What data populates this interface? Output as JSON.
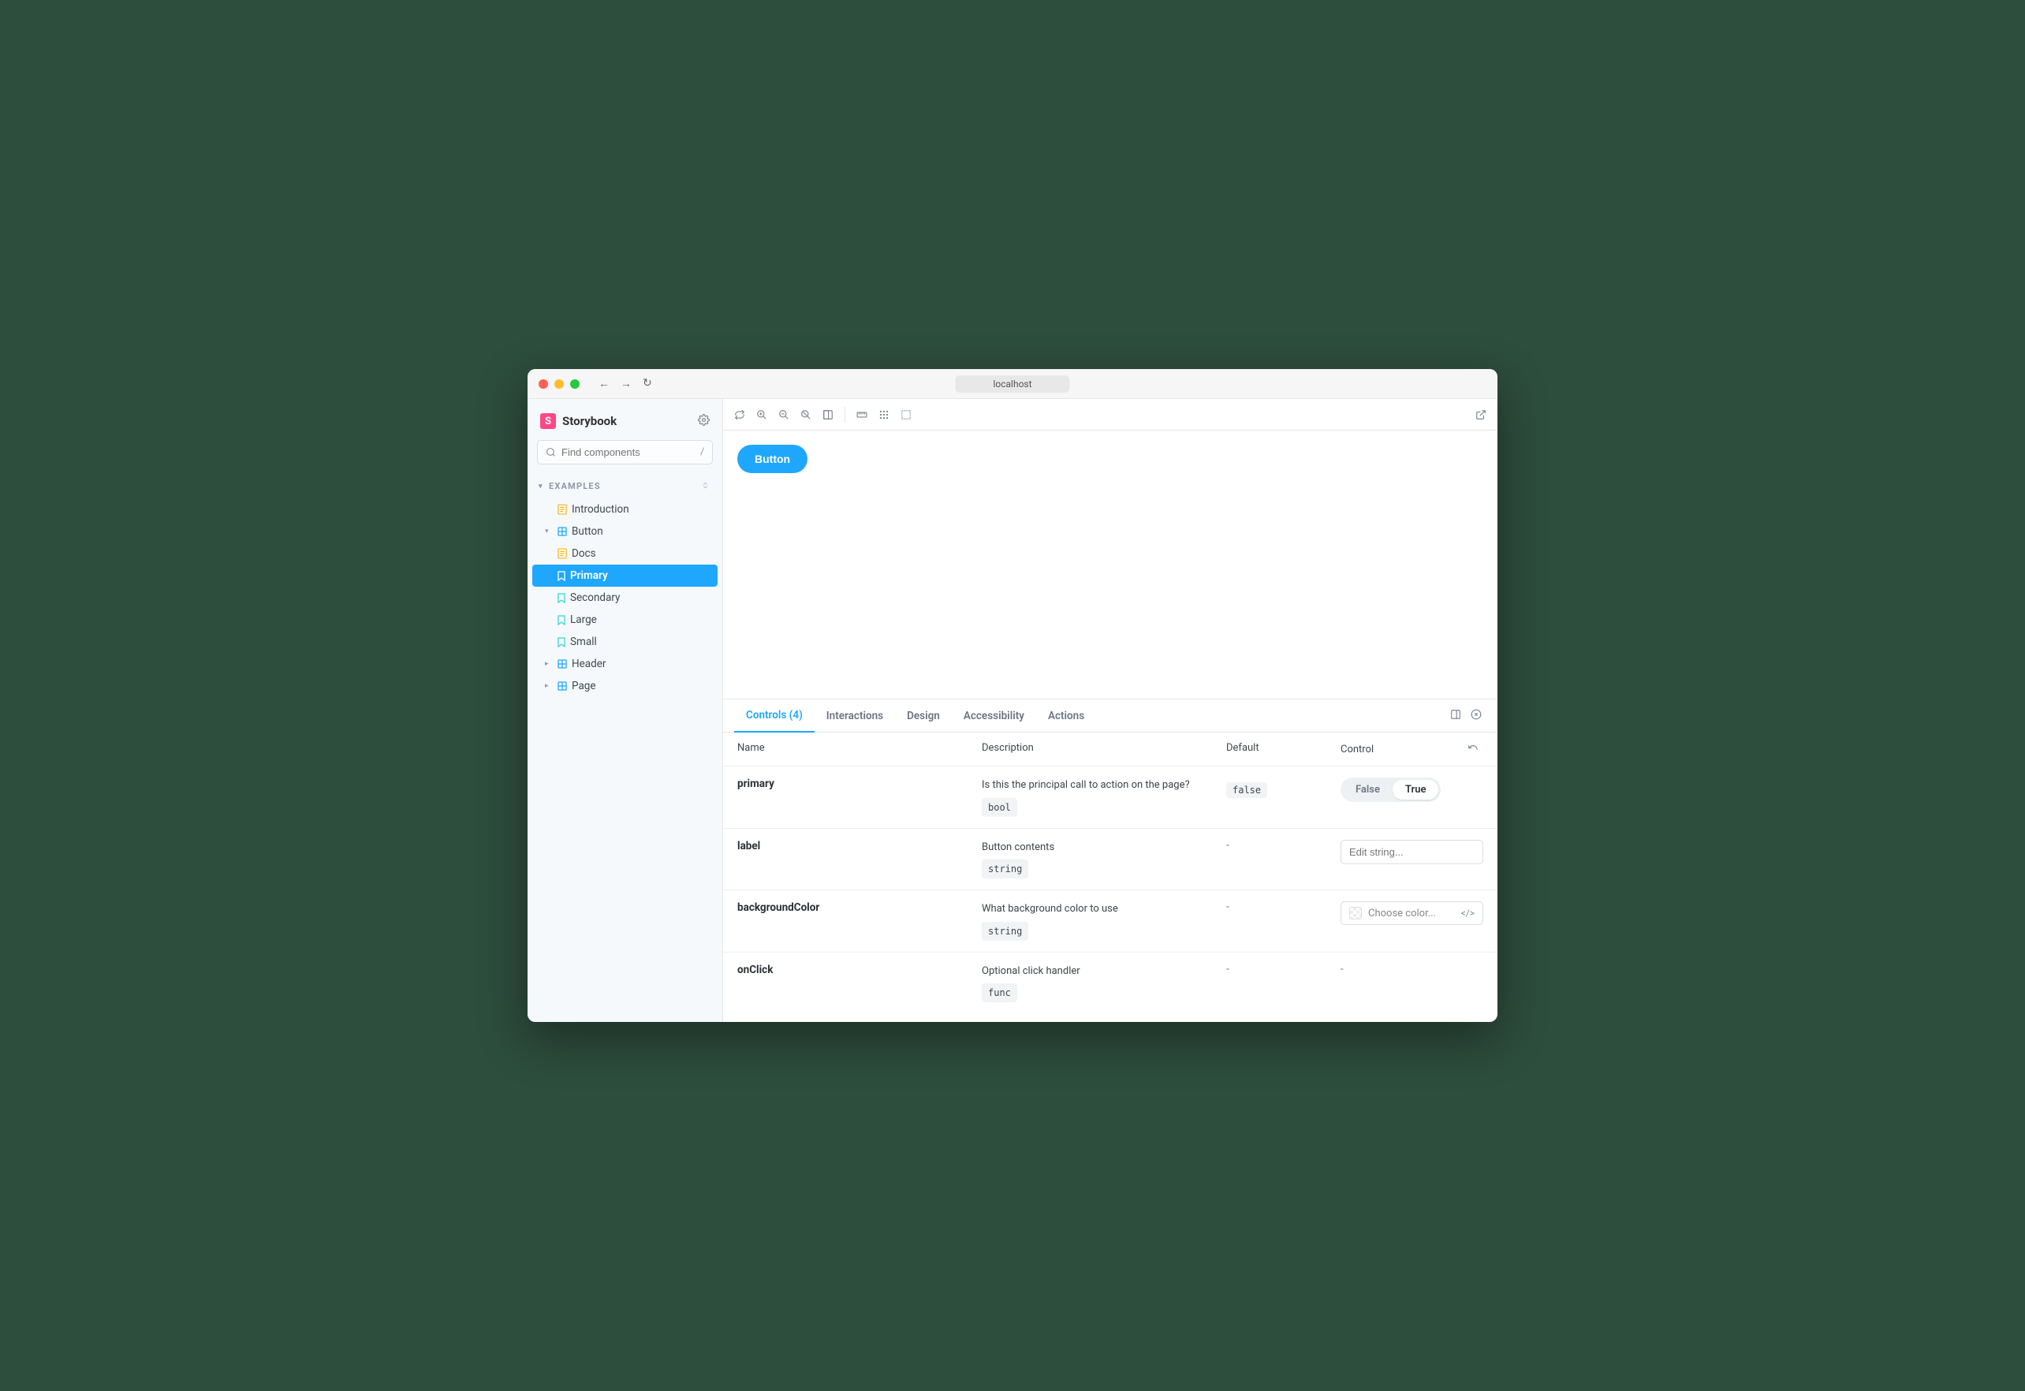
{
  "browser": {
    "url_label": "localhost"
  },
  "brand": {
    "logo_letter": "S",
    "name": "Storybook"
  },
  "search": {
    "placeholder": "Find components",
    "shortcut": "/"
  },
  "section": {
    "label": "EXAMPLES"
  },
  "tree": {
    "introduction": "Introduction",
    "button": "Button",
    "docs": "Docs",
    "primary": "Primary",
    "secondary": "Secondary",
    "large": "Large",
    "small": "Small",
    "header": "Header",
    "page": "Page"
  },
  "canvas": {
    "button_label": "Button"
  },
  "addons": {
    "tabs": {
      "controls": "Controls (4)",
      "interactions": "Interactions",
      "design": "Design",
      "accessibility": "Accessibility",
      "actions": "Actions"
    },
    "columns": {
      "name": "Name",
      "description": "Description",
      "default": "Default",
      "control": "Control"
    },
    "rows": {
      "primary": {
        "name": "primary",
        "desc": "Is this the principal call to action on the page?",
        "type": "bool",
        "default": "false"
      },
      "label": {
        "name": "label",
        "desc": "Button contents",
        "type": "string",
        "default": "-",
        "placeholder": "Edit string..."
      },
      "backgroundColor": {
        "name": "backgroundColor",
        "desc": "What background color to use",
        "type": "string",
        "default": "-",
        "picker_label": "Choose color..."
      },
      "onClick": {
        "name": "onClick",
        "desc": "Optional click handler",
        "type": "func",
        "default": "-",
        "control": "-"
      }
    },
    "bool": {
      "false": "False",
      "true": "True"
    }
  }
}
